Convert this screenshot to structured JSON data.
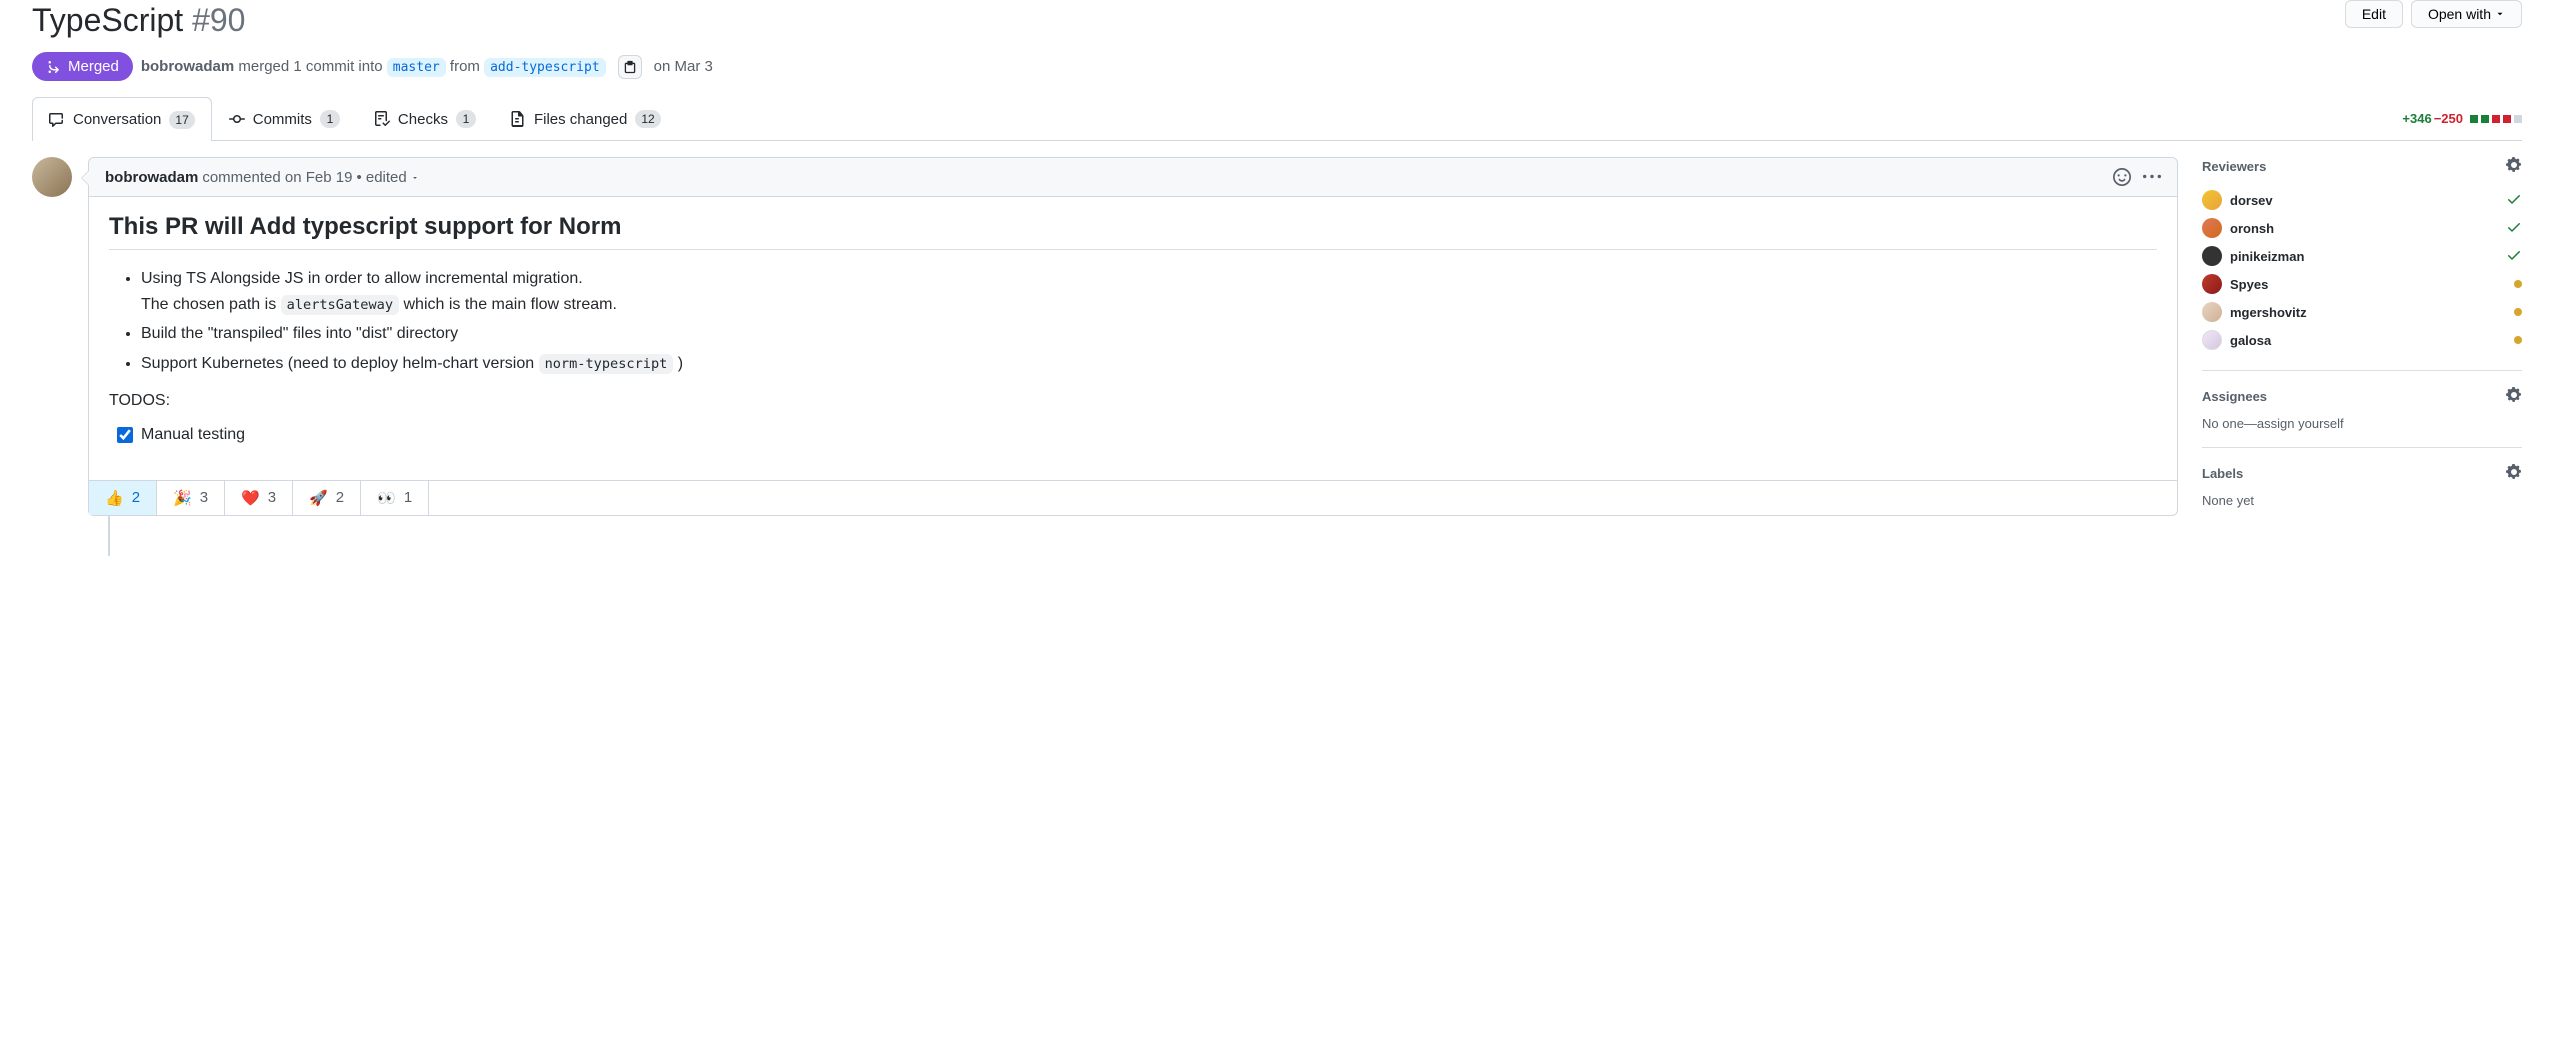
{
  "header": {
    "title": "TypeScript",
    "pr_number": "#90",
    "edit_btn": "Edit",
    "open_with_btn": "Open with"
  },
  "state": {
    "label": "Merged"
  },
  "meta": {
    "author": "bobrowadam",
    "action_text": "merged 1 commit into",
    "base_branch": "master",
    "from_text": "from",
    "head_branch": "add-typescript",
    "date_text": "on Mar 3"
  },
  "tabs": {
    "conversation": {
      "label": "Conversation",
      "count": "17"
    },
    "commits": {
      "label": "Commits",
      "count": "1"
    },
    "checks": {
      "label": "Checks",
      "count": "1"
    },
    "files": {
      "label": "Files changed",
      "count": "12"
    }
  },
  "diffstat": {
    "additions": "+346",
    "deletions": "−250"
  },
  "comment": {
    "author": "bobrowadam",
    "meta_text": "commented on Feb 19",
    "edited_text": "• edited",
    "body_heading": "This PR will Add typescript support for Norm",
    "li1_a": "Using TS Alongside JS in order to allow incremental migration.",
    "li1_b": "The chosen path is ",
    "li1_code": "alertsGateway",
    "li1_c": " which is the main flow stream.",
    "li2": "Build the \"transpiled\" files into \"dist\" directory",
    "li3_a": "Support Kubernetes (need to deploy helm-chart version ",
    "li3_code": "norm-typescript",
    "li3_b": " )",
    "todos_label": "TODOS:",
    "task1": "Manual testing"
  },
  "reactions": [
    {
      "emoji": "👍",
      "count": "2",
      "selected": true
    },
    {
      "emoji": "🎉",
      "count": "3",
      "selected": false
    },
    {
      "emoji": "❤️",
      "count": "3",
      "selected": false
    },
    {
      "emoji": "🚀",
      "count": "2",
      "selected": false
    },
    {
      "emoji": "👀",
      "count": "1",
      "selected": false
    }
  ],
  "sidebar": {
    "reviewers": {
      "title": "Reviewers",
      "list": [
        {
          "name": "dorsev",
          "status": "check"
        },
        {
          "name": "oronsh",
          "status": "check"
        },
        {
          "name": "pinikeizman",
          "status": "check"
        },
        {
          "name": "Spyes",
          "status": "pending"
        },
        {
          "name": "mgershovitz",
          "status": "pending"
        },
        {
          "name": "galosa",
          "status": "pending"
        }
      ]
    },
    "assignees": {
      "title": "Assignees",
      "text": "No one—assign yourself"
    },
    "labels": {
      "title": "Labels",
      "text": "None yet"
    }
  }
}
